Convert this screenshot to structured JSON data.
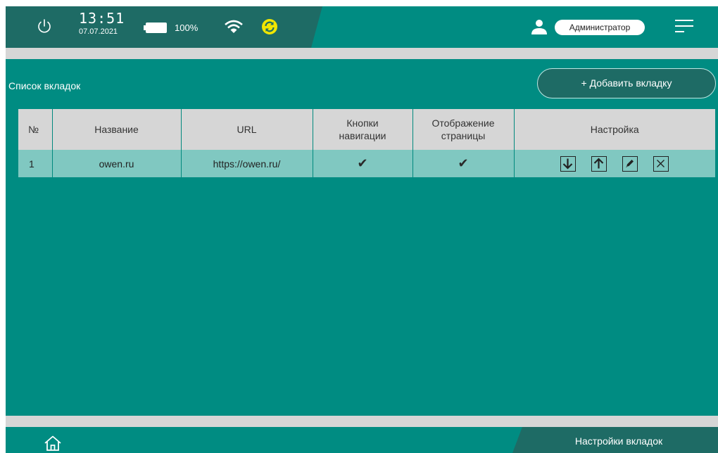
{
  "status": {
    "time": "13:51",
    "date": "07.07.2021",
    "battery": "100%",
    "user": "Администратор"
  },
  "page": {
    "section_title": "Список вкладок",
    "add_button": "+ Добавить вкладку",
    "bottom_tab": "Настройки вкладок"
  },
  "table": {
    "headers": {
      "num": "№",
      "name": "Название",
      "url": "URL",
      "nav_line1": "Кнопки",
      "nav_line2": "навигации",
      "display_line1": "Отображение",
      "display_line2": "страницы",
      "settings": "Настройка"
    },
    "rows": [
      {
        "num": "1",
        "name": "owen.ru",
        "url": "https://owen.ru/",
        "nav_buttons": "✔",
        "page_display": "✔"
      }
    ]
  },
  "icons": [
    "power-icon",
    "battery-icon",
    "wifi-icon",
    "sync-icon",
    "user-icon",
    "menu-icon",
    "arrow-down-icon",
    "arrow-up-icon",
    "edit-icon",
    "close-icon",
    "home-icon"
  ],
  "colors": {
    "primary": "#008c82",
    "dark": "#1e6b65",
    "row": "#80c8c1",
    "header": "#d6d6d6",
    "sync": "#f0e600"
  }
}
